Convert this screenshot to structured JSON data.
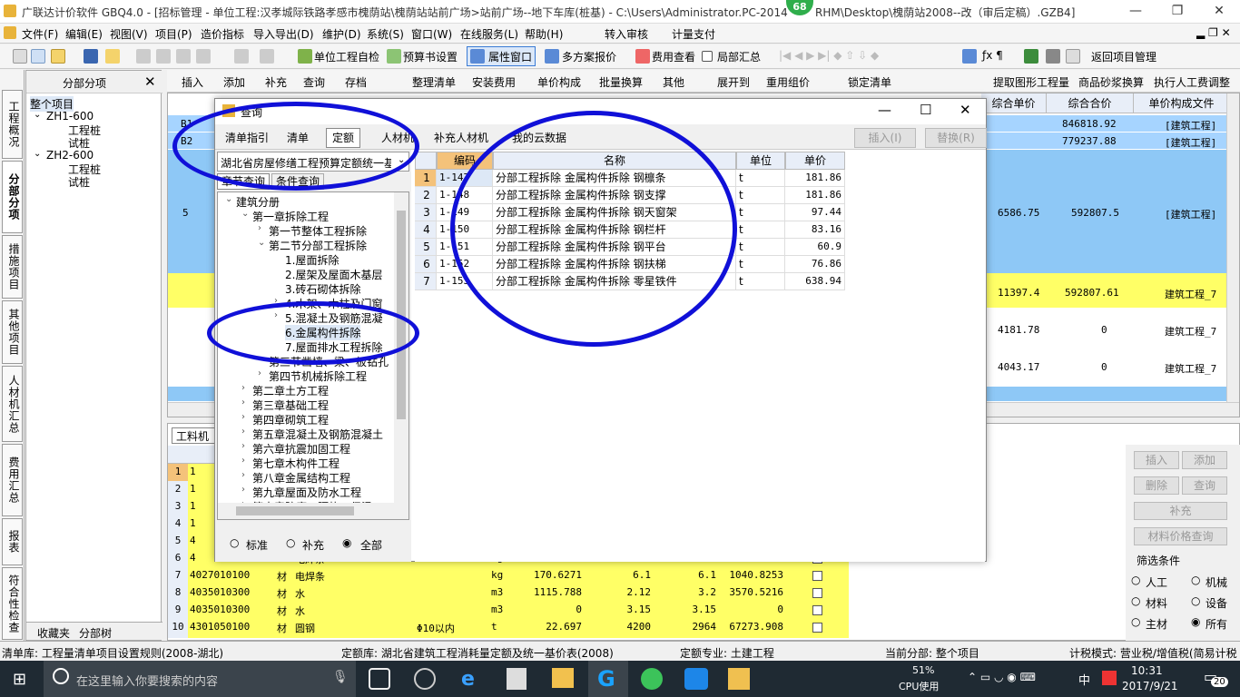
{
  "window": {
    "title": "广联达计价软件 GBQ4.0 - [招标管理 - 单位工程:汉孝城际铁路孝感市槐荫站\\槐荫站站前广场>站前广场--地下车库(桩基) - C:\\Users\\Administrator.PC-2014",
    "title_tail": "RHM\\Desktop\\槐荫站2008--改（审后定稿）.GZB4]",
    "badge": "68",
    "minimize": "—",
    "restore": "❐",
    "close": "✕"
  },
  "menu": [
    "文件(F)",
    "编辑(E)",
    "视图(V)",
    "项目(P)",
    "造价指标",
    "导入导出(D)",
    "维护(D)",
    "系统(S)",
    "窗口(W)",
    "在线服务(L)",
    "帮助(H)",
    "转入审核",
    "计量支付"
  ],
  "toolbar1": {
    "items": [
      "单位工程自检",
      "预算书设置",
      "属性窗口",
      "多方案报价",
      "费用查看",
      "局部汇总",
      "返回项目管理"
    ]
  },
  "toolbar2": {
    "items": [
      "插入",
      "添加",
      "补充",
      "查询",
      "存档",
      "整理清单",
      "安装费用",
      "单价构成",
      "批量换算",
      "其他",
      "展开到",
      "重用组价",
      "锁定清单",
      "提取图形工程量",
      "商品砂浆换算",
      "执行人工费调整"
    ]
  },
  "sidetabs": [
    "工程概况",
    "分部分项",
    "措施项目",
    "其他项目",
    "人材机汇总",
    "费用汇总",
    "报表",
    "符合性检查"
  ],
  "tree": {
    "header": "分部分项",
    "close": "✕",
    "items": [
      "整个项目",
      "ZH1-600",
      "工程桩",
      "试桩",
      "ZH2-600",
      "工程桩",
      "试桩"
    ],
    "bottom_tabs": [
      "收藏夹",
      "分部树"
    ]
  },
  "grid": {
    "headers": [
      "综合单价",
      "综合合价",
      "单价构成文件"
    ],
    "rows": [
      {
        "code": "B1",
        "unit_price": "",
        "total": "846818.92",
        "file": "[建筑工程]"
      },
      {
        "code": "B2",
        "unit_price": "",
        "total": "779237.88",
        "file": "[建筑工程]"
      },
      {
        "code": "5",
        "unit_price": "6586.75",
        "total": "592807.5",
        "file": "[建筑工程]"
      },
      {
        "code": "",
        "unit_price": "11397.4",
        "total": "592807.61",
        "file": "建筑工程_7"
      },
      {
        "code": "",
        "unit_price": "4181.78",
        "total": "0",
        "file": "建筑工程_7"
      },
      {
        "code": "",
        "unit_price": "4043.17",
        "total": "0",
        "file": "建筑工程_7"
      }
    ]
  },
  "lower_table": {
    "tab": "工料机显",
    "rows": [
      {
        "n": "1",
        "code": "1",
        "type": "",
        "name": "",
        "spec": "",
        "unit": "",
        "qty": "",
        "p1": "",
        "p2": "",
        "sum": ""
      },
      {
        "n": "2",
        "code": "1",
        "type": "",
        "name": "",
        "spec": "",
        "unit": "",
        "qty": "",
        "p1": "",
        "p2": "",
        "sum": ""
      },
      {
        "n": "3",
        "code": "1",
        "type": "",
        "name": "",
        "spec": "",
        "unit": "",
        "qty": "",
        "p1": "",
        "p2": "",
        "sum": ""
      },
      {
        "n": "4",
        "code": "1",
        "type": "",
        "name": "",
        "spec": "",
        "unit": "",
        "qty": "",
        "p1": "",
        "p2": "",
        "sum": ""
      },
      {
        "n": "5",
        "code": "4",
        "type": "",
        "name": "",
        "spec": "",
        "unit": "",
        "qty": "",
        "p1": "",
        "p2": "",
        "sum": ""
      },
      {
        "n": "6",
        "code": "4",
        "type": "",
        "name": "电焊条",
        "spec": "",
        "unit": "kg",
        "qty": "",
        "p1": "",
        "p2": "",
        "sum": ""
      },
      {
        "n": "7",
        "code": "4027010100",
        "type": "材",
        "name": "电焊条",
        "spec": "",
        "unit": "kg",
        "qty": "170.6271",
        "p1": "6.1",
        "p2": "6.1",
        "sum": "1040.8253"
      },
      {
        "n": "8",
        "code": "4035010300",
        "type": "材",
        "name": "水",
        "spec": "",
        "unit": "m3",
        "qty": "1115.788",
        "p1": "2.12",
        "p2": "3.2",
        "sum": "3570.5216"
      },
      {
        "n": "9",
        "code": "4035010300",
        "type": "材",
        "name": "水",
        "spec": "",
        "unit": "m3",
        "qty": "0",
        "p1": "3.15",
        "p2": "3.15",
        "sum": "0"
      },
      {
        "n": "10",
        "code": "4301050100",
        "type": "材",
        "name": "圆钢",
        "spec": "Φ10以内",
        "unit": "t",
        "qty": "22.697",
        "p1": "4200",
        "p2": "2964",
        "sum": "67273.908"
      }
    ]
  },
  "right_panel": {
    "buttons": [
      "插入",
      "添加",
      "删除",
      "查询",
      "补充",
      "材料价格查询"
    ],
    "filter_label": "筛选条件",
    "options": [
      "人工",
      "机械",
      "材料",
      "设备",
      "主材",
      "所有"
    ],
    "selected": "所有"
  },
  "dialog": {
    "title": "查询",
    "tabs": [
      "清单指引",
      "清单",
      "定额",
      "人材机",
      "补充人材机",
      "我的云数据"
    ],
    "active_tab": "定额",
    "insert_btn": "插入(I)",
    "replace_btn": "替换(R)",
    "library": "湖北省房屋修缮工程预算定额统一基",
    "subtabs": [
      "章节查询",
      "条件查询"
    ],
    "tree": [
      {
        "label": "建筑分册",
        "level": 0,
        "exp": "⌄"
      },
      {
        "label": "第一章拆除工程",
        "level": 1,
        "exp": "⌄"
      },
      {
        "label": "第一节整体工程拆除",
        "level": 2,
        "exp": "›"
      },
      {
        "label": "第二节分部工程拆除",
        "level": 2,
        "exp": "⌄"
      },
      {
        "label": "1.屋面拆除",
        "level": 3,
        "exp": ""
      },
      {
        "label": "2.屋架及屋面木基层",
        "level": 3,
        "exp": ""
      },
      {
        "label": "3.砖石砌体拆除",
        "level": 3,
        "exp": ""
      },
      {
        "label": "4.木架、木柱及门窗",
        "level": 3,
        "exp": "›"
      },
      {
        "label": "5.混凝土及钢筋混凝",
        "level": 3,
        "exp": "›"
      },
      {
        "label": "6.金属构件拆除",
        "level": 3,
        "exp": ""
      },
      {
        "label": "7.屋面排水工程拆除",
        "level": 3,
        "exp": ""
      },
      {
        "label": "第三节凿墙、梁、板钻孔",
        "level": 2,
        "exp": "›"
      },
      {
        "label": "第四节机械拆除工程",
        "level": 2,
        "exp": "›"
      },
      {
        "label": "第二章土方工程",
        "level": 1,
        "exp": "›"
      },
      {
        "label": "第三章基础工程",
        "level": 1,
        "exp": "›"
      },
      {
        "label": "第四章砌筑工程",
        "level": 1,
        "exp": "›"
      },
      {
        "label": "第五章混凝土及钢筋混凝土",
        "level": 1,
        "exp": "›"
      },
      {
        "label": "第六章抗震加固工程",
        "level": 1,
        "exp": "›"
      },
      {
        "label": "第七章木构件工程",
        "level": 1,
        "exp": "›"
      },
      {
        "label": "第八章金属结构工程",
        "level": 1,
        "exp": "›"
      },
      {
        "label": "第九章屋面及防水工程",
        "level": 1,
        "exp": "›"
      },
      {
        "label": "第十章防腐、隔热、保温工",
        "level": 1,
        "exp": "›"
      }
    ],
    "radios": [
      "标准",
      "补充",
      "全部"
    ],
    "radio_selected": "全部",
    "table_headers": [
      "",
      "编码",
      "名称",
      "单位",
      "单价"
    ],
    "rows": [
      {
        "n": "1",
        "code": "1-147",
        "name": "分部工程拆除 金属构件拆除 钢檩条",
        "unit": "t",
        "price": "181.86"
      },
      {
        "n": "2",
        "code": "1-148",
        "name": "分部工程拆除 金属构件拆除 钢支撑",
        "unit": "t",
        "price": "181.86"
      },
      {
        "n": "3",
        "code": "1-149",
        "name": "分部工程拆除 金属构件拆除 钢天窗架",
        "unit": "t",
        "price": "97.44"
      },
      {
        "n": "4",
        "code": "1-150",
        "name": "分部工程拆除 金属构件拆除 钢栏杆",
        "unit": "t",
        "price": "83.16"
      },
      {
        "n": "5",
        "code": "1-151",
        "name": "分部工程拆除 金属构件拆除 钢平台",
        "unit": "t",
        "price": "60.9"
      },
      {
        "n": "6",
        "code": "1-152",
        "name": "分部工程拆除 金属构件拆除 钢扶梯",
        "unit": "t",
        "price": "76.86"
      },
      {
        "n": "7",
        "code": "1-153",
        "name": "分部工程拆除 金属构件拆除 零星铁件",
        "unit": "t",
        "price": "638.94"
      }
    ]
  },
  "status": {
    "list_lib": "清单库: 工程量清单项目设置规则(2008-湖北)",
    "quota_lib": "定额库: 湖北省建筑工程消耗量定额及统一基价表(2008)",
    "specialty": "定额专业: 土建工程",
    "current": "当前分部: 整个项目",
    "tax": "计税模式: 营业税/增值税(简易计税"
  },
  "taskbar": {
    "search_placeholder": "在这里输入你要搜索的内容",
    "cpu": "51%",
    "cpu_label": "CPU使用",
    "time": "10:31",
    "date": "2017/9/21",
    "notif": "20",
    "ime": "中"
  },
  "colors": {
    "annotation": "#1010d8",
    "highlight": "#ffff66",
    "selected": "#a6d4ff"
  }
}
